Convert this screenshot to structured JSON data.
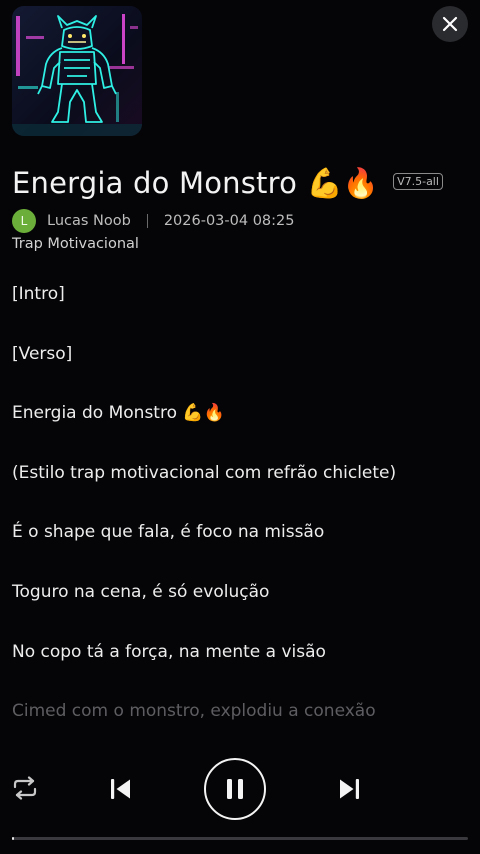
{
  "colors": {
    "background": "#050507",
    "avatar": "#6cae3a",
    "neon_cyan": "#2ff0e4",
    "neon_pink": "#e04ad9"
  },
  "header": {
    "cover_icon": "neon-monster-artwork",
    "close_icon": "close-icon"
  },
  "song": {
    "title": "Energia do Monstro 💪🔥",
    "version": "V7.5-all",
    "author_initial": "L",
    "author": "Lucas Noob",
    "timestamp": "2026-03-04 08:25",
    "genre": "Trap Motivacional"
  },
  "lyrics": [
    "[Intro]",
    "[Verso]",
    "Energia do Monstro 💪🔥",
    "(Estilo trap motivacional com refrão chiclete)",
    "É o shape que fala, é foco na missão",
    "Toguro na cena, é só evolução",
    "No copo tá a força, na mente a visão",
    "Cimed com o monstro, explodiu a conexão"
  ],
  "player": {
    "repeat_icon": "repeat-icon",
    "previous_icon": "skip-previous-icon",
    "pause_icon": "pause-icon",
    "next_icon": "skip-next-icon",
    "progress_fraction": 0.005
  }
}
